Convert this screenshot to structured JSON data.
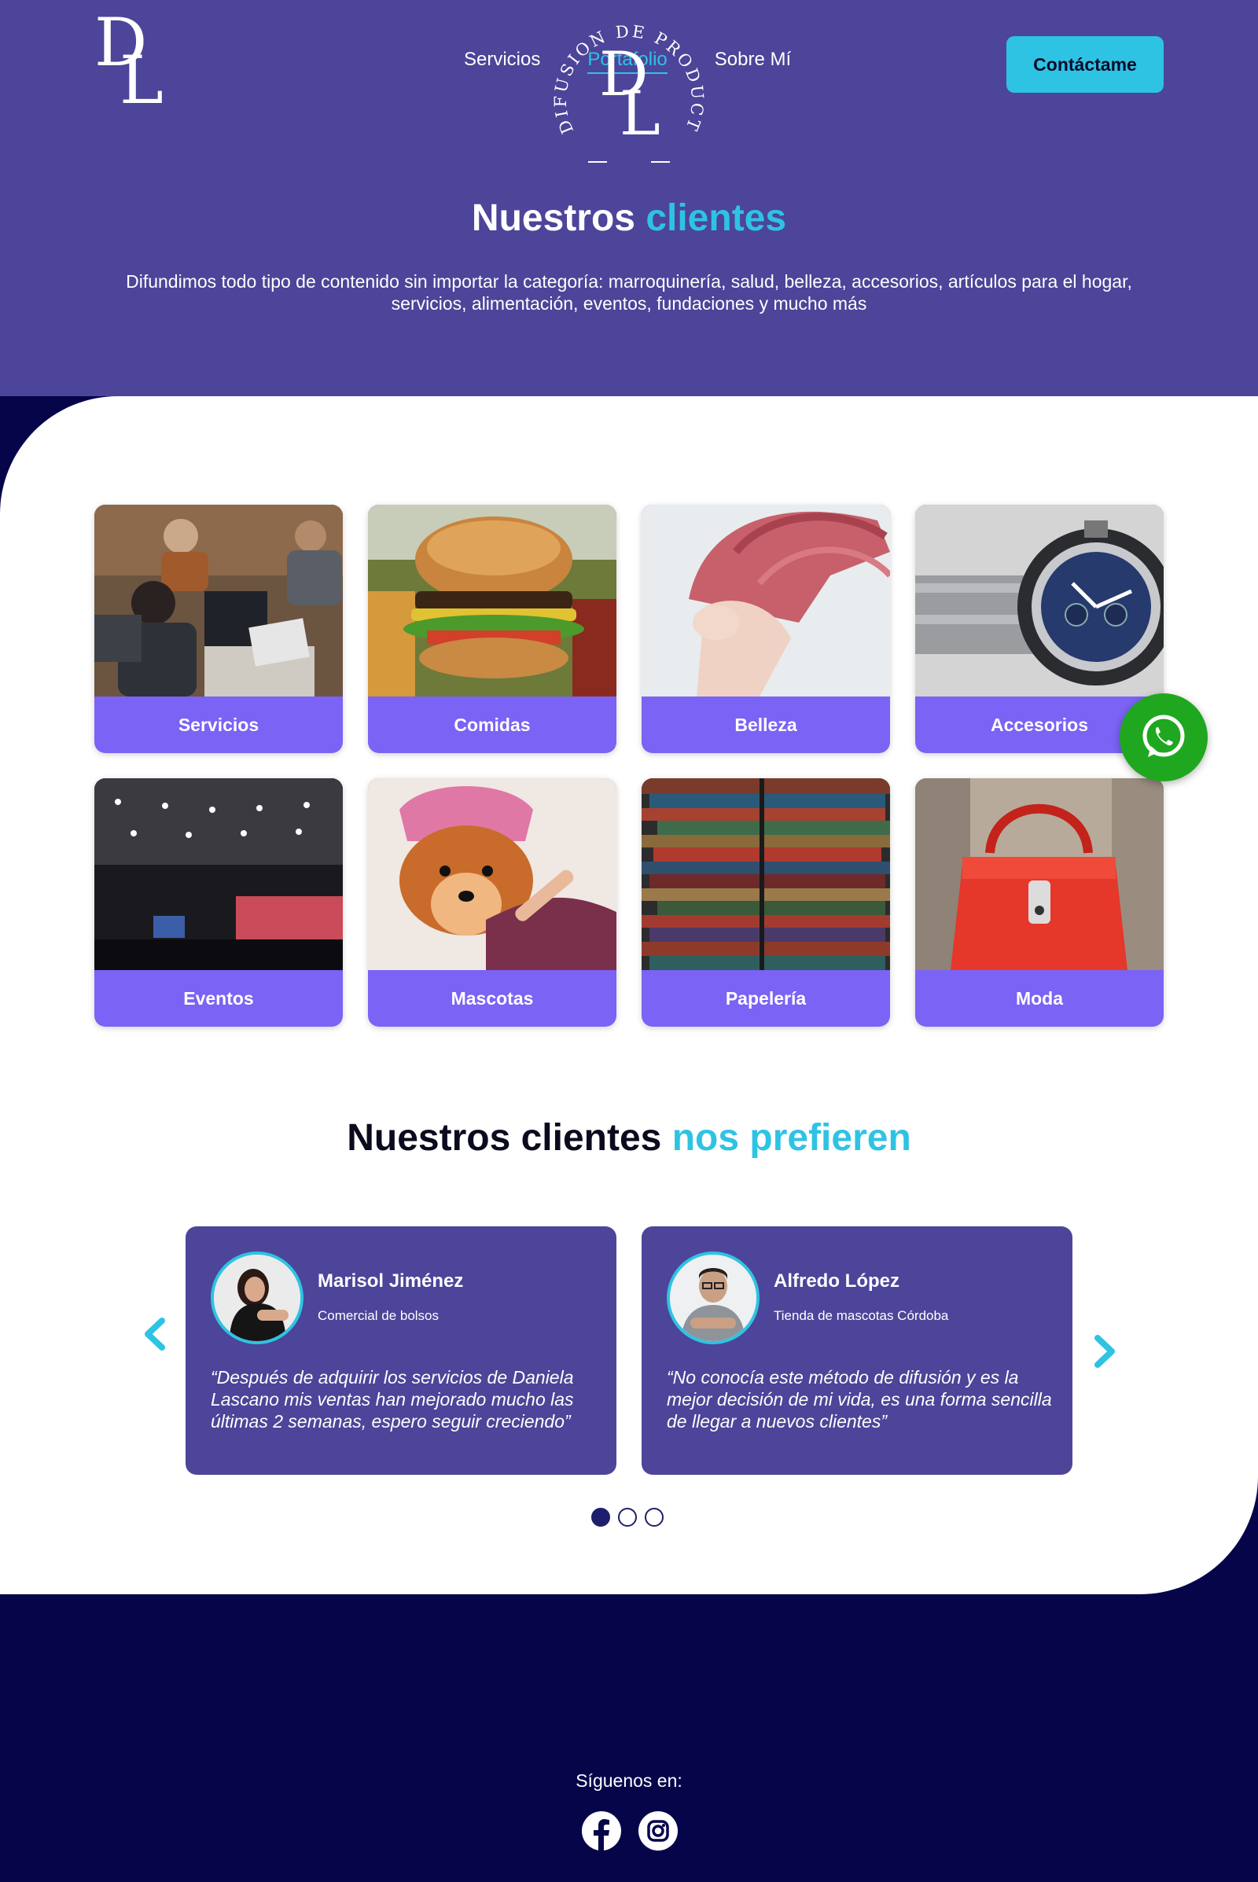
{
  "brand": {
    "logo_letters": "DL",
    "footer_logo_ring": "DIFUSION DE PRODUCTOS"
  },
  "nav": {
    "items": [
      "Servicios",
      "Portafolio",
      "Sobre Mí"
    ],
    "active": "Portafolio",
    "cta_label": "Contáctame"
  },
  "hero": {
    "title_main": "Nuestros",
    "title_accent": "clientes",
    "description": "Difundimos todo tipo de contenido sin importar la categoría: marroquinería, salud,  belleza, accesorios, artículos para el hogar, servicios, alimentación, eventos, fundaciones y mucho más"
  },
  "categories": [
    {
      "label": "Servicios",
      "image": "people-working-on-laptops"
    },
    {
      "label": "Comidas",
      "image": "burger-and-fries"
    },
    {
      "label": "Belleza",
      "image": "woman-with-pink-hair"
    },
    {
      "label": "Accesorios",
      "image": "wrist-watch"
    },
    {
      "label": "Eventos",
      "image": "conference-hall"
    },
    {
      "label": "Mascotas",
      "image": "dog-with-towel"
    },
    {
      "label": "Papelería",
      "image": "stacked-books"
    },
    {
      "label": "Moda",
      "image": "red-handbag"
    }
  ],
  "testimonials_section": {
    "title_main": "Nuestros clientes",
    "title_accent": "nos prefieren"
  },
  "testimonials": [
    {
      "name": "Marisol Jiménez",
      "role": "Comercial de bolsos",
      "quote": "“Después de adquirir los servicios de Daniela Lascano mis ventas han mejorado mucho las últimas 2 semanas, espero seguir creciendo”"
    },
    {
      "name": "Alfredo López",
      "role": "Tienda de mascotas Córdoba",
      "quote": "“No conocía este método de difusión y es la mejor decisión de mi vida, es una forma sencilla de llegar a nuevos clientes”"
    }
  ],
  "carousel": {
    "pages": 3,
    "active_page": 1
  },
  "footer": {
    "follow_label": "Síguenos en:",
    "social": [
      "facebook-icon",
      "instagram-icon"
    ]
  },
  "colors": {
    "primary": "#4c4599",
    "accent": "#2ec3e3",
    "card": "#7a63f5",
    "footer": "#07054a",
    "whatsapp": "#1fa81f"
  }
}
